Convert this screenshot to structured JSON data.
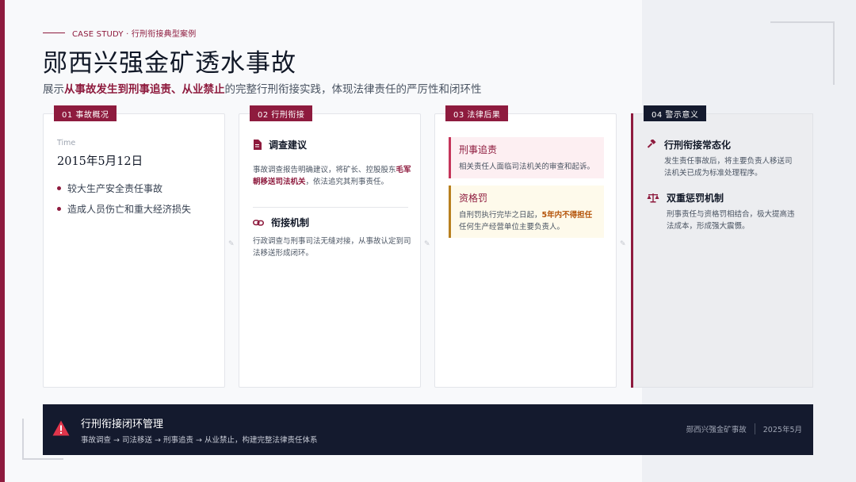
{
  "header": {
    "eyebrow": "CASE STUDY · 行刑衔接典型案例",
    "title": "郧西兴强金矿透水事故",
    "subtitle_pre": "展示",
    "subtitle_hl": "从事故发生到刑事追责、从业禁止",
    "subtitle_post": "的完整行刑衔接实践，体现法律责任的严厉性和闭环性"
  },
  "cards": [
    {
      "tag": "01 事故概况",
      "time_label": "Time",
      "time_value": "2015年5月12日",
      "bullets": [
        "较大生产安全责任事故",
        "造成人员伤亡和重大经济损失"
      ]
    },
    {
      "tag": "02 行刑衔接",
      "sections": [
        {
          "icon": "document-icon",
          "title": "调查建议",
          "body_pre": "事故调查报告明确建议，将矿长、控股股东",
          "body_hl": "毛军朝移送司法机关",
          "body_post": "，依法追究其刑事责任。"
        },
        {
          "icon": "link-icon",
          "title": "衔接机制",
          "body": "行政调查与刑事司法无缝对接，从事故认定到司法移送形成闭环。"
        }
      ]
    },
    {
      "tag": "03 法律后果",
      "boxes": [
        {
          "title": "刑事追责",
          "body": "相关责任人面临司法机关的审查和起诉。",
          "color": "#c5355a"
        },
        {
          "title": "资格罚",
          "body_pre": "自刑罚执行完毕之日起，",
          "body_hl": "5年内不得担任",
          "body_post": "任何生产经营单位主要负责人。",
          "color": "#b8801f"
        }
      ]
    },
    {
      "tag": "04 警示意义",
      "items": [
        {
          "icon": "gavel-icon",
          "title": "行刑衔接常态化",
          "body": "发生责任事故后，将主要负责人移送司法机关已成为标准处理程序。"
        },
        {
          "icon": "scales-icon",
          "title": "双重惩罚机制",
          "body": "刑事责任与资格罚相结合，极大提高违法成本，形成强大震慑。"
        }
      ]
    }
  ],
  "footer": {
    "icon": "warning-icon",
    "title": "行刑衔接闭环管理",
    "desc": "事故调查 → 司法移送 → 刑事追责 → 从业禁止，构建完整法律责任体系",
    "case_name": "郧西兴强金矿事故",
    "date": "2025年5月"
  },
  "colors": {
    "accent": "#8e1b3e",
    "navy": "#141a2e",
    "warning": "#e0354b"
  }
}
